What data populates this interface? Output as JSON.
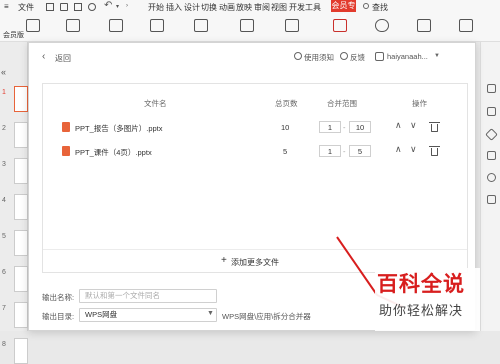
{
  "menubar": {
    "hamburger": "≡",
    "file": "文件",
    "start": "开始",
    "insert": "插入",
    "design": "设计",
    "switch": "切换",
    "animation": "动画",
    "slideshow": "放映",
    "review": "审阅",
    "view": "视图",
    "developer": "开发工具",
    "vip": "会员专享",
    "search": "查找",
    "member_tab": "会员版"
  },
  "sidebar": {
    "collapse": "«",
    "slides": [
      "1",
      "2",
      "3",
      "4",
      "5",
      "6",
      "7",
      "8"
    ]
  },
  "dialog": {
    "back": "返回",
    "help": "使用须知",
    "feedback": "反馈",
    "user": "haiyanaah...",
    "headers": {
      "name": "文件名",
      "pages": "总页数",
      "range": "合并范围",
      "ops": "操作"
    },
    "files": [
      {
        "name": "PPT_报告（多图片）.pptx",
        "pages": "10",
        "from": "1",
        "to": "10"
      },
      {
        "name": "PPT_课件（4页）.pptx",
        "pages": "5",
        "from": "1",
        "to": "5"
      }
    ],
    "range_sep": "-",
    "add_more": "添加更多文件",
    "add_icon": "+",
    "output_name_label": "输出名称:",
    "output_name_placeholder": "默认和第一个文件同名",
    "output_dir_label": "输出目录:",
    "output_dir_value": "WPS网盘",
    "output_path": "WPS网盘\\应用\\拆分合并器"
  },
  "watermark": {
    "line1": "百科全说",
    "line2": "助你轻松解决"
  },
  "colors": {
    "accent": "#e23b2d",
    "watermark_red": "#d81e1e",
    "file_icon": "#e8643a"
  }
}
